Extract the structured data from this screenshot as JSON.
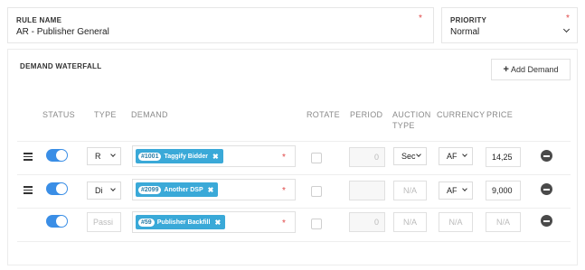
{
  "rule_name": {
    "label": "RULE NAME",
    "value": "AR - Publisher General",
    "required": "*"
  },
  "priority": {
    "label": "PRIORITY",
    "value": "Normal",
    "required": "*"
  },
  "waterfall": {
    "title": "DEMAND WATERFALL",
    "add_button": {
      "icon": "+",
      "label": "Add Demand"
    },
    "columns": {
      "status": "STATUS",
      "type": "TYPE",
      "demand": "DEMAND",
      "rotate": "ROTATE",
      "period": "PERIOD",
      "auction_type_1": "AUCTION",
      "auction_type_2": "TYPE",
      "currency": "CURRENCY",
      "price": "PRICE"
    },
    "rows": [
      {
        "type": "R",
        "demand_id": "#1001",
        "demand_name": "Taggify Bidder",
        "demand_remove": "✖",
        "required": "*",
        "period": "0",
        "auction": "Sec",
        "currency": "AF",
        "price": "14,25"
      },
      {
        "type": "Di",
        "demand_id": "#2099",
        "demand_name": "Another DSP",
        "demand_remove": "✖",
        "required": "*",
        "period": "",
        "auction": "N/A",
        "currency": "AF",
        "price": "9,000"
      },
      {
        "type": "Passi",
        "demand_id": "#59",
        "demand_name": "Publisher Backfill",
        "demand_remove": "✖",
        "required": "*",
        "period": "0",
        "auction": "N/A",
        "currency": "N/A",
        "price": "N/A"
      }
    ]
  }
}
